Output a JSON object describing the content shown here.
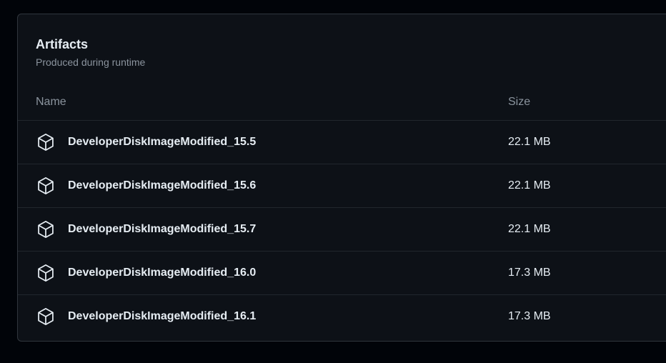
{
  "artifacts": {
    "title": "Artifacts",
    "subtitle": "Produced during runtime",
    "columns": {
      "name": "Name",
      "size": "Size"
    },
    "rows": [
      {
        "name": "DeveloperDiskImageModified_15.5",
        "size": "22.1 MB",
        "icon": "package-icon"
      },
      {
        "name": "DeveloperDiskImageModified_15.6",
        "size": "22.1 MB",
        "icon": "package-icon"
      },
      {
        "name": "DeveloperDiskImageModified_15.7",
        "size": "22.1 MB",
        "icon": "package-icon"
      },
      {
        "name": "DeveloperDiskImageModified_16.0",
        "size": "17.3 MB",
        "icon": "package-icon"
      },
      {
        "name": "DeveloperDiskImageModified_16.1",
        "size": "17.3 MB",
        "icon": "package-icon"
      }
    ]
  },
  "colors": {
    "background": "#010409",
    "panel": "#0d1117",
    "border": "#30363d",
    "text": "#e6edf3",
    "muted": "#8b949e"
  }
}
